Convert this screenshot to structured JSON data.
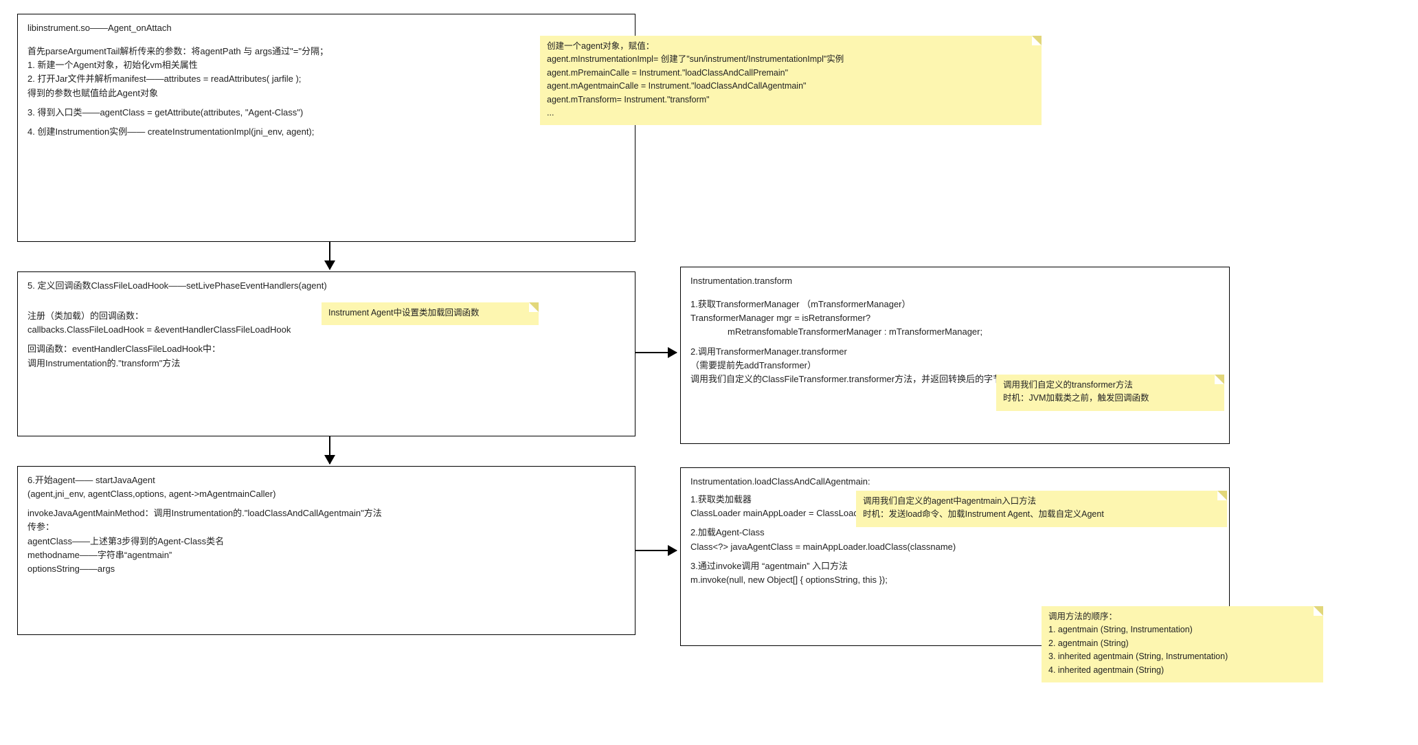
{
  "box1": {
    "title": "libinstrument.so——Agent_onAttach",
    "line_intro": "首先parseArgumentTail解析传来的参数：将agentPath 与 args通过\"=\"分隔；",
    "step1": "1. 新建一个Agent对象，初始化vm相关属性",
    "step2": "2. 打开Jar文件并解析manifest——attributes = readAttributes( jarfile );",
    "step2b": "得到的参数也赋值给此Agent对象",
    "step3": "3. 得到入口类——agentClass = getAttribute(attributes, \"Agent-Class\")",
    "step4": "4. 创建Instrumention实例—— createInstrumentationImpl(jni_env, agent);"
  },
  "sticky1": {
    "l1": "创建一个agent对象，赋值：",
    "l2": "agent.mInstrumentationImpl= 创建了\"sun/instrument/InstrumentationImpl\"实例",
    "l3": "agent.mPremainCalle =  Instrument.\"loadClassAndCallPremain\"",
    "l4": "agent.mAgentmainCalle =  Instrument.\"loadClassAndCallAgentmain\"",
    "l5": "agent.mTransform= Instrument.\"transform\"",
    "l6": "..."
  },
  "box2": {
    "step5": "5. 定义回调函数ClassFileLoadHook——setLivePhaseEventHandlers(agent)",
    "l2": "注册（类加载）的回调函数：",
    "l3": "callbacks.ClassFileLoadHook = &eventHandlerClassFileLoadHook",
    "l4": "回调函数：eventHandlerClassFileLoadHook中：",
    "l5": "调用Instrumentation的.\"transform\"方法"
  },
  "sticky2": {
    "l1": "Instrument Agent中设置类加载回调函数"
  },
  "box3": {
    "step6": "6.开始agent—— startJavaAgent",
    "step6b": "(agent,jni_env, agentClass,options,  agent->mAgentmainCaller)",
    "l2": "invokeJavaAgentMainMethod：调用Instrumentation的.\"loadClassAndCallAgentmain\"方法",
    "l3": "传参：",
    "l4": "agentClass——上述第3步得到的Agent-Class类名",
    "l5": "methodname——字符串“agentmain”",
    "l6": "optionsString——args"
  },
  "box4": {
    "title": "Instrumentation.transform",
    "l1": "1.获取TransformerManager （mTransformerManager）",
    "l2": "TransformerManager mgr = isRetransformer?",
    "l3": "mRetransfomableTransformerManager : mTransformerManager;",
    "l4": "2.调用TransformerManager.transformer",
    "l5": "（需要提前先addTransformer）",
    "l6": "调用我们自定义的ClassFileTransformer.transformer方法，并返回转换后的字节码transformedBytes"
  },
  "sticky3": {
    "l1": "调用我们自定义的transformer方法",
    "l2": "时机：JVM加载类之前，触发回调函数"
  },
  "box5": {
    "title": "Instrumentation.loadClassAndCallAgentmain:",
    "l1": "1.获取类加载器",
    "l1b": "ClassLoader mainAppLoader   = ClassLoader.getSystemClassLoader();",
    "l2": "2.加载Agent-Class",
    "l2b": "Class<?>   javaAgentClass  = mainAppLoader.loadClass(classname)",
    "l3": "3.通过invoke调用 “agentmain” 入口方法",
    "l3b": " m.invoke(null, new Object[] { optionsString, this });"
  },
  "sticky4": {
    "l1": "调用我们自定义的agent中agentmain入口方法",
    "l2": "时机：发送load命令、加载Instrument Agent、加载自定义Agent"
  },
  "sticky5": {
    "l1": "调用方法的顺序：",
    "l2": "1. agentmain (String, Instrumentation)",
    "l3": "2. agentmain (String)",
    "l4": "3. inherited agentmain (String, Instrumentation)",
    "l5": "4. inherited agentmain (String)"
  }
}
